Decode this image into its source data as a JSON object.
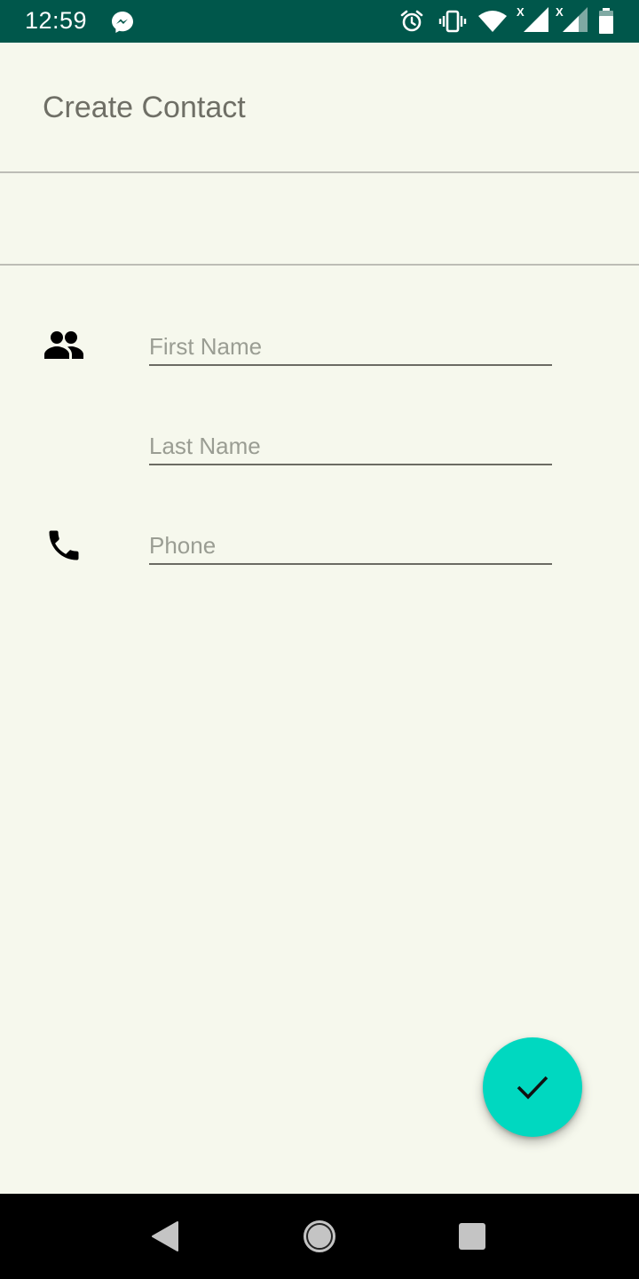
{
  "status_bar": {
    "time": "12:59",
    "icons": [
      "messenger-icon",
      "alarm-icon",
      "vibrate-icon",
      "wifi-icon",
      "signal-icon",
      "signal-icon",
      "battery-icon"
    ]
  },
  "app": {
    "title": "Create Contact"
  },
  "form": {
    "first_name": {
      "value": "",
      "placeholder": "First Name",
      "icon": "people-icon"
    },
    "last_name": {
      "value": "",
      "placeholder": "Last Name"
    },
    "phone": {
      "value": "",
      "placeholder": "Phone",
      "icon": "phone-icon"
    }
  },
  "fab": {
    "icon": "check-icon",
    "color": "#00d8c0"
  },
  "navigation": {
    "buttons": [
      "back-icon",
      "home-icon",
      "recents-icon"
    ]
  },
  "colors": {
    "status_bar": "#00574b",
    "background": "#f6f8ed",
    "accent": "#00d8c0"
  }
}
